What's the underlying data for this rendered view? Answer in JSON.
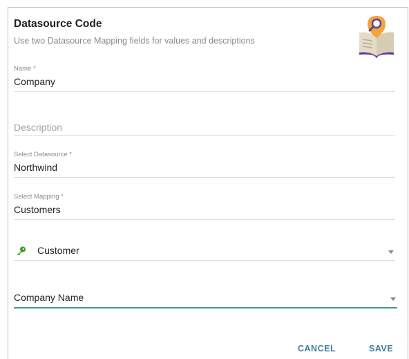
{
  "dialog": {
    "title": "Datasource Code",
    "subtitle": "Use two Datasource Mapping fields for values and descriptions"
  },
  "fields": {
    "name": {
      "label": "Name *",
      "value": "Company"
    },
    "description": {
      "placeholder": "Description"
    },
    "datasource": {
      "label": "Select Datasource *",
      "value": "Northwind"
    },
    "mapping": {
      "label": "Select Mapping *",
      "value": "Customers"
    },
    "key_field": {
      "value": "Customer",
      "icon": "key-icon",
      "icon_color": "#3e9a2b"
    },
    "description_field": {
      "value": "Company Name"
    }
  },
  "actions": {
    "cancel_label": "CANCEL",
    "save_label": "SAVE"
  },
  "colors": {
    "accent": "#3e7f97",
    "focus_underline": "#3d9a8b"
  }
}
